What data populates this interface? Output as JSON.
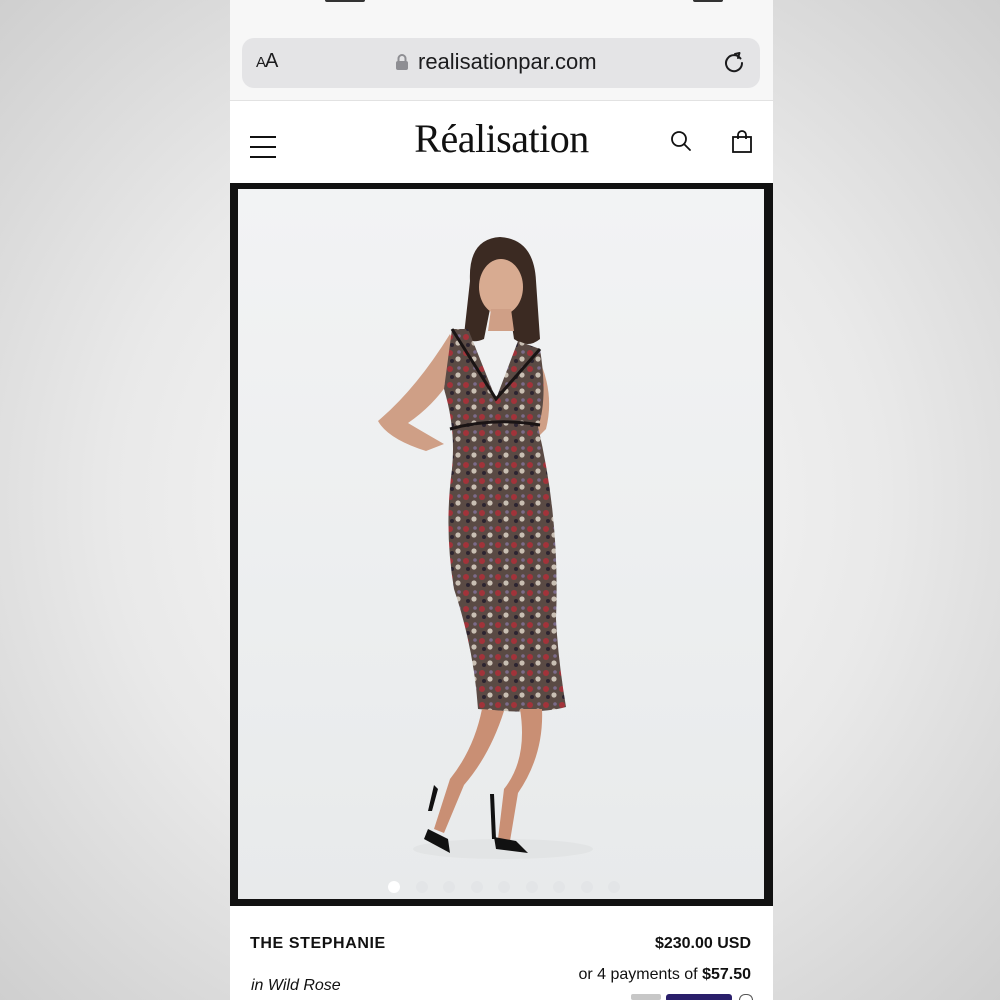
{
  "browser": {
    "text_size_small": "A",
    "text_size_large": "A",
    "url": "realisationpar.com"
  },
  "header": {
    "brand": "Réalisation"
  },
  "product": {
    "name": "THE STEPHANIE",
    "colorway": "in Wild Rose",
    "price": "$230.00 USD",
    "installments_prefix": "or 4 payments of ",
    "installment_amount": "$57.50"
  },
  "carousel": {
    "total": 9,
    "active_index": 0
  },
  "colors": {
    "frame": "#111111",
    "background": "#eef0f1",
    "text": "#111111"
  }
}
